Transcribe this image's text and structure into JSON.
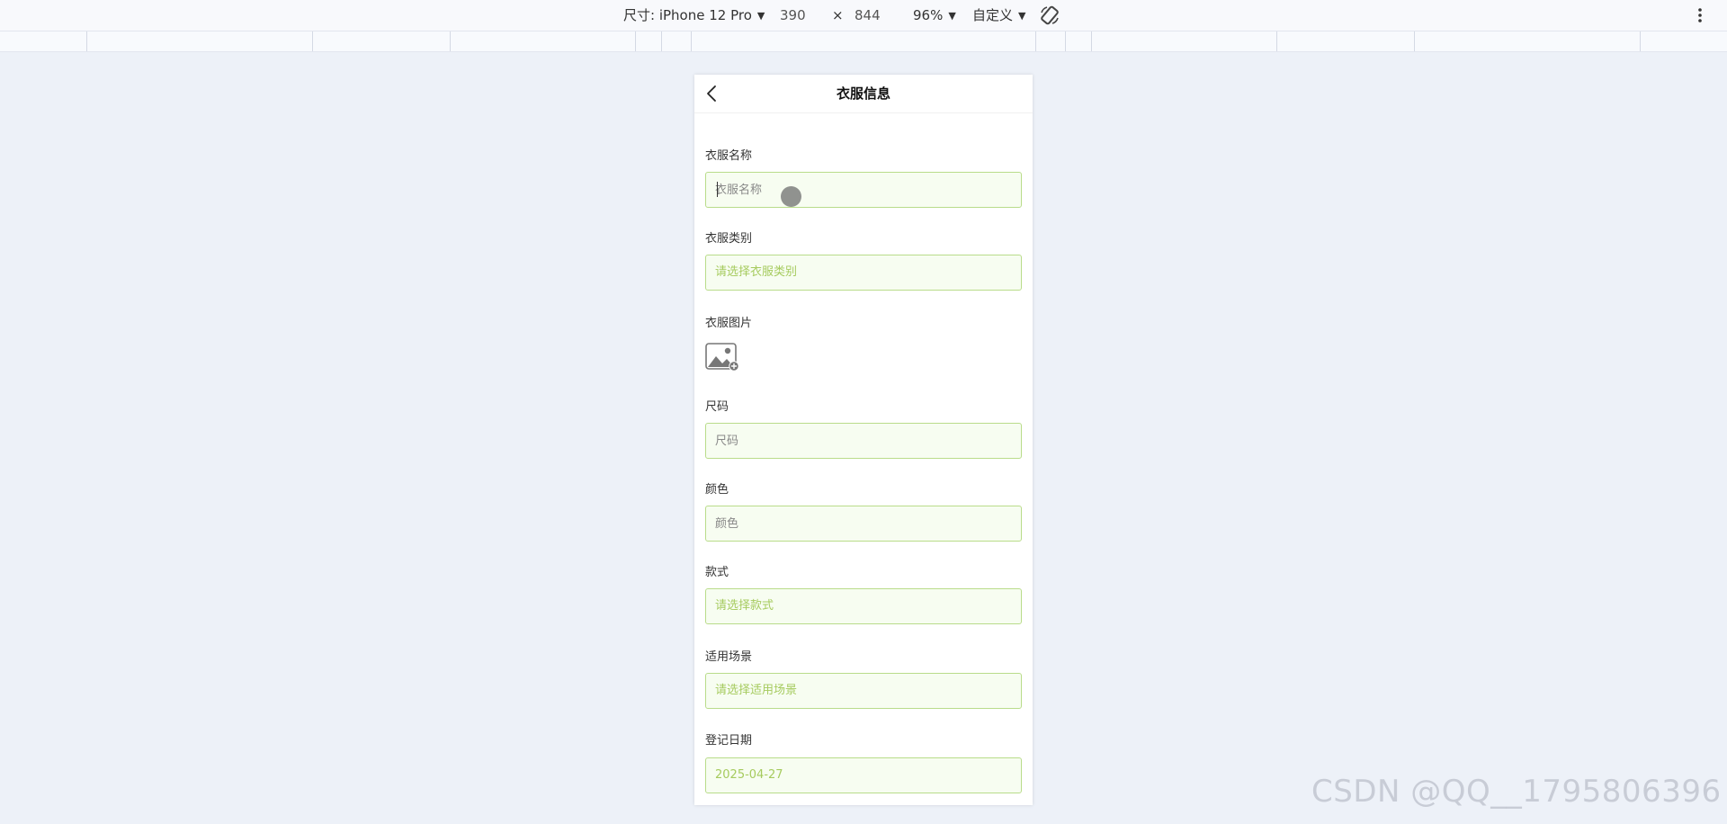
{
  "devtools": {
    "device_label": "尺寸: iPhone 12 Pro",
    "width": "390",
    "times": "×",
    "height": "844",
    "zoom": "96%",
    "throttle": "自定义"
  },
  "page": {
    "title": "衣服信息"
  },
  "form": {
    "name": {
      "label": "衣服名称",
      "placeholder": "衣服名称"
    },
    "category": {
      "label": "衣服类别",
      "value": "请选择衣服类别"
    },
    "image": {
      "label": "衣服图片"
    },
    "size": {
      "label": "尺码",
      "placeholder": "尺码"
    },
    "color": {
      "label": "颜色",
      "placeholder": "颜色"
    },
    "style": {
      "label": "款式",
      "value": "请选择款式"
    },
    "scene": {
      "label": "适用场景",
      "value": "请选择适用场景"
    },
    "date": {
      "label": "登记日期",
      "value": "2025-04-27"
    }
  },
  "colors": {
    "input_border": "#b9dc8a",
    "input_bg": "#f7fdf1",
    "select_text": "#a6cb5e",
    "page_bg": "#edf1f8"
  },
  "watermark": "CSDN @QQ__1795806396"
}
